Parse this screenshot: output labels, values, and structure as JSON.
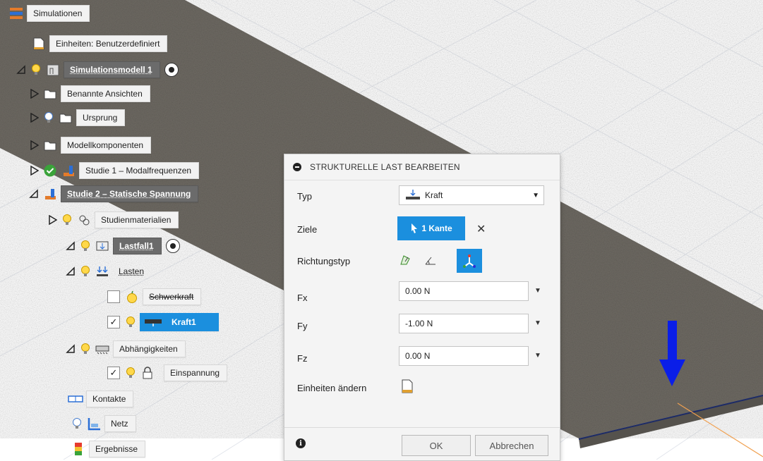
{
  "tree": {
    "root": "Simulationen",
    "units": "Einheiten: Benutzerdefiniert",
    "model": "Simulationsmodell 1",
    "named_views": "Benannte Ansichten",
    "origin": "Ursprung",
    "components": "Modellkomponenten",
    "study1": "Studie 1 – Modalfrequenzen",
    "study2": "Studie 2 – Statische Spannung",
    "materials": "Studienmaterialien",
    "loadcase": "Lastfall1",
    "loads": "Lasten",
    "gravity": "Schwerkraft",
    "force": "Kraft1",
    "constraints": "Abhängigkeiten",
    "fixed": "Einspannung",
    "contacts": "Kontakte",
    "mesh": "Netz",
    "results": "Ergebnisse",
    "checkmark": "✓"
  },
  "dialog": {
    "title": "STRUKTURELLE LAST BEARBEITEN",
    "type_label": "Typ",
    "type_value": "Kraft",
    "targets_label": "Ziele",
    "targets_value": "1 Kante",
    "clear_symbol": "✕",
    "direction_label": "Richtungstyp",
    "fx_label": "Fx",
    "fx_value": "0.00 N",
    "fy_label": "Fy",
    "fy_value": "-1.00 N",
    "fz_label": "Fz",
    "fz_value": "0.00 N",
    "units_label": "Einheiten ändern",
    "ok": "OK",
    "cancel": "Abbrechen",
    "dropdown_arrow": "▼"
  },
  "colors": {
    "selection": "#1b8fde",
    "force_arrow": "#0a1ee8",
    "plate": "#6e6a63",
    "edge": "#1d2b66",
    "axis": "#f0a050"
  }
}
